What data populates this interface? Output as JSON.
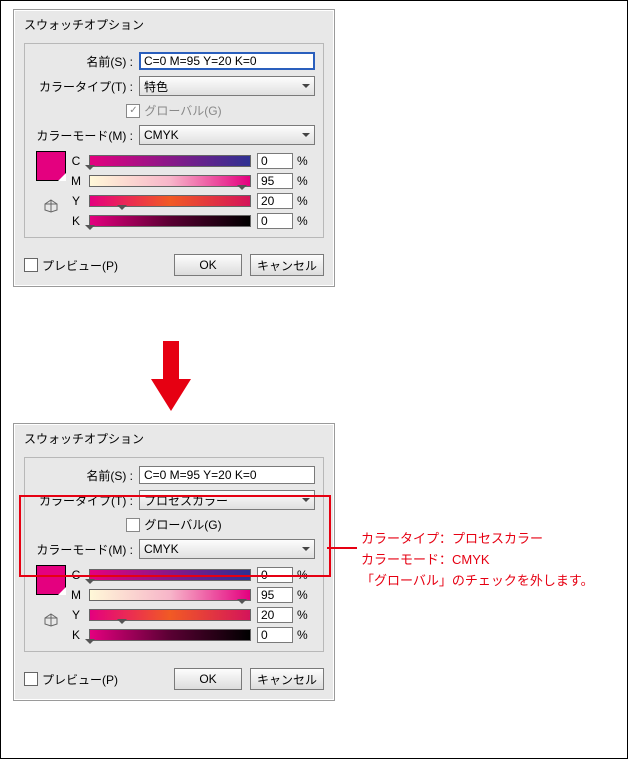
{
  "dialog1": {
    "title": "スウォッチオプション",
    "name_label": "名前(S) :",
    "name_value": "C=0 M=95 Y=20 K=0",
    "colortype_label": "カラータイプ(T) :",
    "colortype_value": "特色",
    "global_label": "グローバル(G)",
    "global_checked": true,
    "colormode_label": "カラーモード(M) :",
    "colormode_value": "CMYK",
    "channels": {
      "c": "C",
      "m": "M",
      "y": "Y",
      "k": "K"
    },
    "values": {
      "c": "0",
      "m": "95",
      "y": "20",
      "k": "0"
    },
    "percent": "%",
    "preview_label": "プレビュー(P)",
    "ok_label": "OK",
    "cancel_label": "キャンセル"
  },
  "dialog2": {
    "title": "スウォッチオプション",
    "name_label": "名前(S) :",
    "name_value": "C=0 M=95 Y=20 K=0",
    "colortype_label": "カラータイプ(T) :",
    "colortype_value": "プロセスカラー",
    "global_label": "グローバル(G)",
    "global_checked": false,
    "colormode_label": "カラーモード(M) :",
    "colormode_value": "CMYK",
    "channels": {
      "c": "C",
      "m": "M",
      "y": "Y",
      "k": "K"
    },
    "values": {
      "c": "0",
      "m": "95",
      "y": "20",
      "k": "0"
    },
    "percent": "%",
    "preview_label": "プレビュー(P)",
    "ok_label": "OK",
    "cancel_label": "キャンセル"
  },
  "annotation": {
    "line1": "カラータイプ：プロセスカラー",
    "line2": "カラーモード：CMYK",
    "line3": "「グローバル」のチェックを外します。"
  },
  "colors": {
    "swatch": "#e4007f",
    "accent_red": "#e60012"
  }
}
